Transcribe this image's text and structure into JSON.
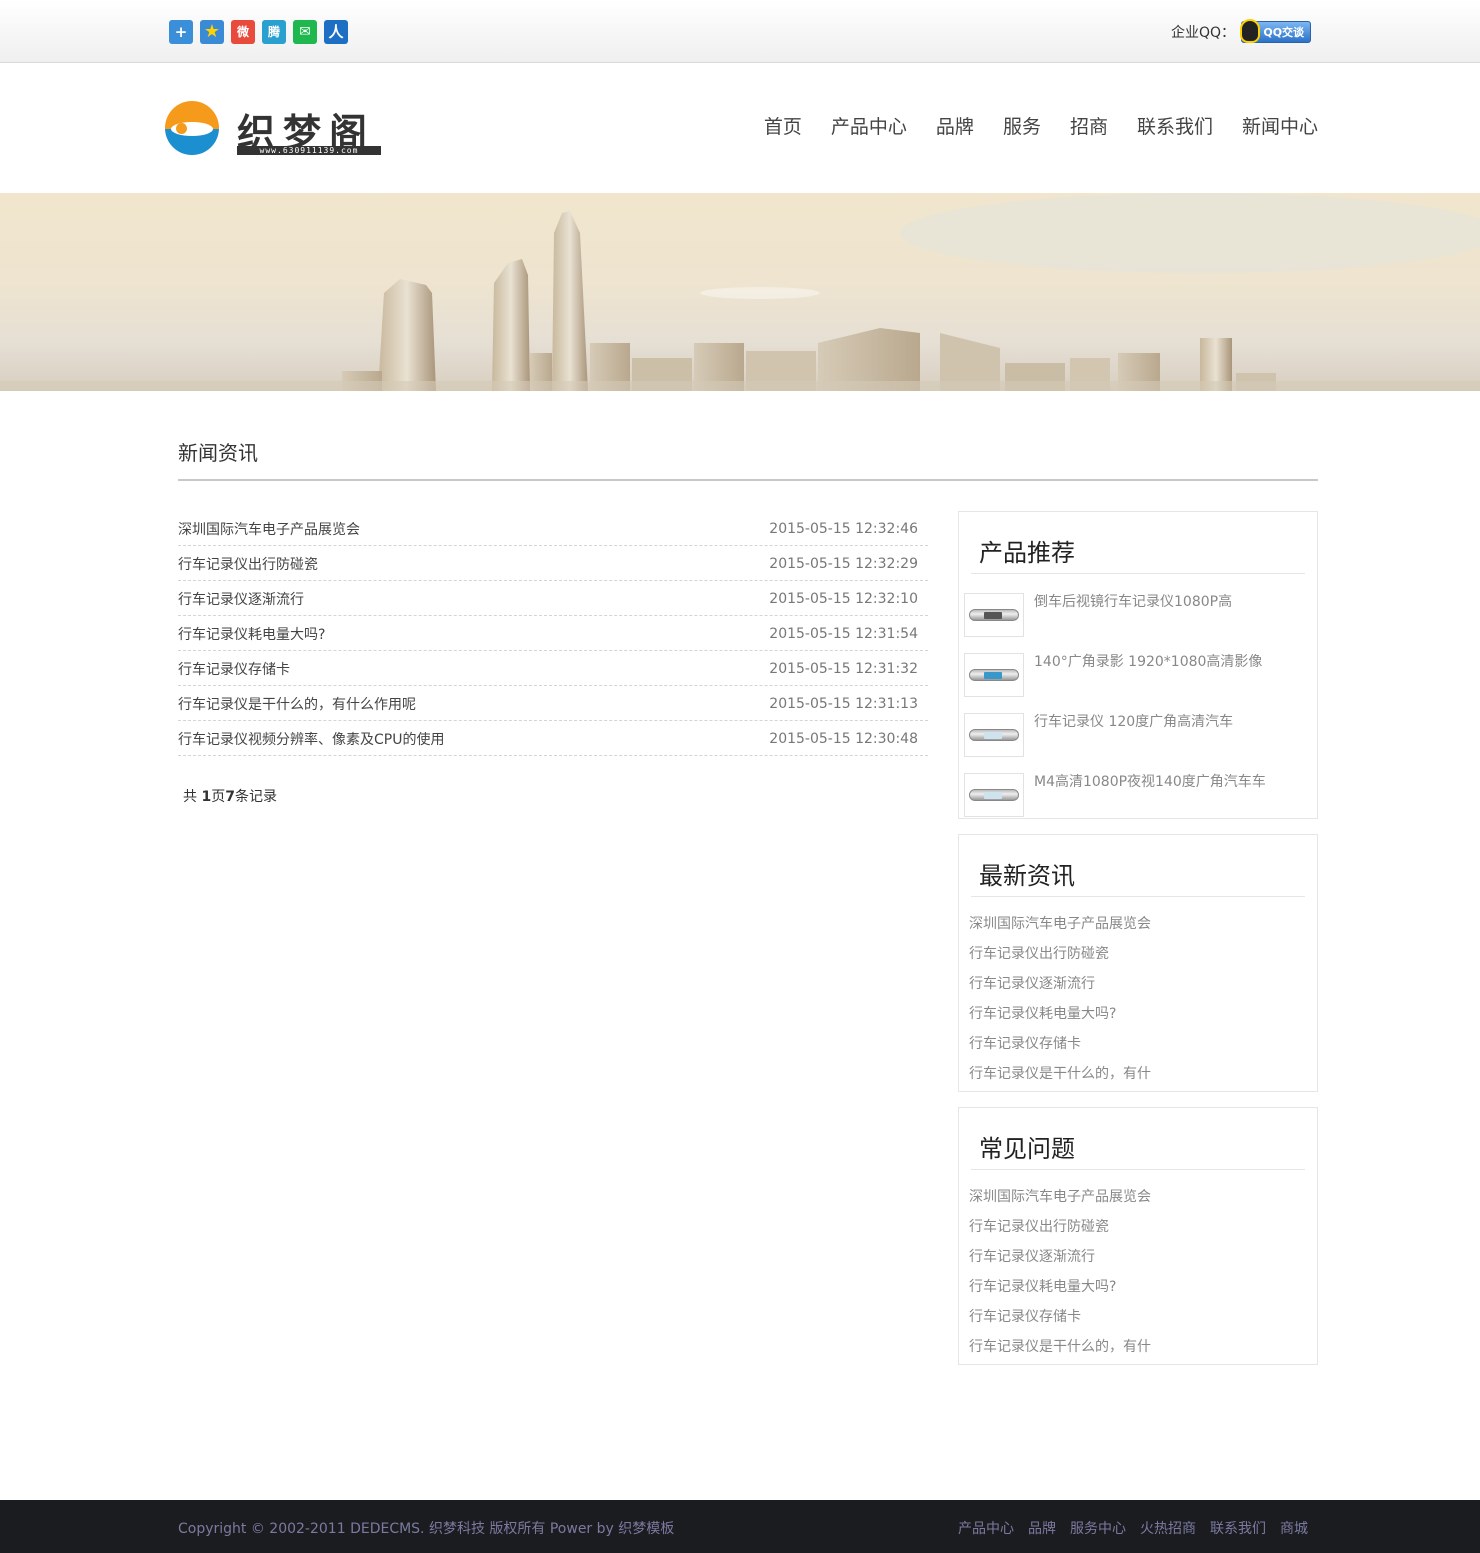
{
  "topbar": {
    "share_icons": [
      "plus-icon",
      "favorite-star-icon",
      "weibo-icon",
      "tencent-weibo-icon",
      "wechat-icon",
      "renren-icon"
    ],
    "qq_label": "企业QQ：",
    "qq_button": "QQ交谈"
  },
  "header": {
    "logo_text": "织梦阁",
    "logo_sub": "www.630911139.com",
    "nav": [
      "首页",
      "产品中心",
      "品牌",
      "服务",
      "招商",
      "联系我们",
      "新闻中心"
    ]
  },
  "main": {
    "section_title": "新闻资讯",
    "news": [
      {
        "title": "深圳国际汽车电子产品展览会",
        "date": "2015-05-15 12:32:46"
      },
      {
        "title": "行车记录仪出行防碰瓷",
        "date": "2015-05-15 12:32:29"
      },
      {
        "title": "行车记录仪逐渐流行",
        "date": "2015-05-15 12:32:10"
      },
      {
        "title": "行车记录仪耗电量大吗?",
        "date": "2015-05-15 12:31:54"
      },
      {
        "title": "行车记录仪存储卡",
        "date": "2015-05-15 12:31:32"
      },
      {
        "title": "行车记录仪是干什么的，有什么作用呢",
        "date": "2015-05-15 12:31:13"
      },
      {
        "title": "行车记录仪视频分辨率、像素及CPU的使用",
        "date": "2015-05-15 12:30:48"
      }
    ],
    "pager": {
      "prefix": "共 ",
      "pages": "1",
      "mid": "页",
      "count": "7",
      "suffix": "条记录"
    }
  },
  "sidebar": {
    "products": {
      "title": "产品推荐",
      "items": [
        "倒车后视镜行车记录仪1080P高",
        "140°广角录影 1920*1080高清影像",
        "行车记录仪 120度广角高清汽车",
        "M4高清1080P夜视140度广角汽车车"
      ]
    },
    "latest": {
      "title": "最新资讯",
      "items": [
        "深圳国际汽车电子产品展览会",
        "行车记录仪出行防碰瓷",
        "行车记录仪逐渐流行",
        "行车记录仪耗电量大吗?",
        "行车记录仪存储卡",
        "行车记录仪是干什么的，有什"
      ]
    },
    "faq": {
      "title": "常见问题",
      "items": [
        "深圳国际汽车电子产品展览会",
        "行车记录仪出行防碰瓷",
        "行车记录仪逐渐流行",
        "行车记录仪耗电量大吗?",
        "行车记录仪存储卡",
        "行车记录仪是干什么的，有什"
      ]
    }
  },
  "footer": {
    "copyright": "Copyright © 2002-2011 DEDECMS. 织梦科技 版权所有 Power by 织梦模板",
    "links": [
      "产品中心",
      "品牌",
      "服务中心",
      "火热招商",
      "联系我们",
      "商城"
    ]
  },
  "colors": {
    "footer_bg": "#1b1c20",
    "footer_text": "#7a7aa0",
    "logo_orange": "#f59a1b",
    "logo_blue": "#1b8fd0"
  }
}
